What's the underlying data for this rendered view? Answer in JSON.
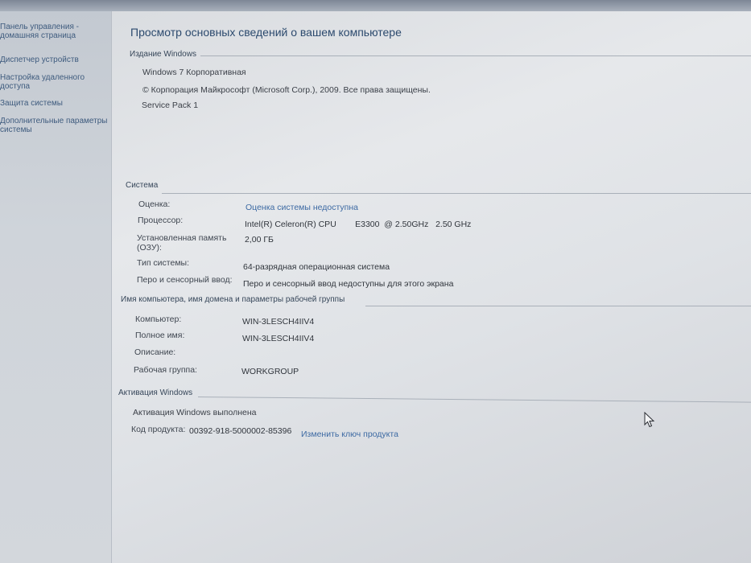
{
  "sidebar": {
    "items": [
      {
        "label": "Панель управления -\nдомашняя страница"
      },
      {
        "label": "Диспетчер устройств"
      },
      {
        "label": "Настройка удаленного\nдоступа"
      },
      {
        "label": "Защита системы"
      },
      {
        "label": "Дополнительные параметры\nсистемы"
      }
    ]
  },
  "main": {
    "title": "Просмотр основных сведений о вашем компьютере",
    "edition": {
      "header": "Издание Windows",
      "name": "Windows 7 Корпоративная",
      "copyright": "© Корпорация Майкрософт (Microsoft Corp.), 2009. Все права защищены.",
      "service_pack": "Service Pack 1"
    },
    "system": {
      "header": "Система",
      "rows": [
        {
          "label": "Оценка:",
          "value": "Оценка системы недоступна"
        },
        {
          "label": "Процессор:",
          "value": "Intel(R) Celeron(R) CPU        E3300  @ 2.50GHz   2.50 GHz"
        },
        {
          "label": "Установленная память\n(ОЗУ):",
          "value": "2,00 ГБ"
        },
        {
          "label": "Тип системы:",
          "value": "64-разрядная операционная система"
        },
        {
          "label": "Перо и сенсорный ввод:",
          "value": "Перо и сенсорный ввод недоступны для этого экрана"
        }
      ]
    },
    "computer": {
      "header": "Имя компьютера, имя домена и параметры рабочей группы",
      "rows": [
        {
          "label": "Компьютер:",
          "value": "WIN-3LESCH4IIV4"
        },
        {
          "label": "Полное имя:",
          "value": "WIN-3LESCH4IIV4"
        },
        {
          "label": "Описание:",
          "value": ""
        },
        {
          "label": "Рабочая группа:",
          "value": "WORKGROUP"
        }
      ]
    },
    "activation": {
      "header": "Активация Windows",
      "status": "Активация Windows выполнена",
      "product_key_label": "Код продукта:",
      "product_key": "00392-918-5000002-85396",
      "change_key_link": "Изменить ключ продукта"
    }
  },
  "colors": {
    "link": "#3d6aa3",
    "title": "#2c4a6e",
    "sidebar_bg": "#cfd4da"
  }
}
